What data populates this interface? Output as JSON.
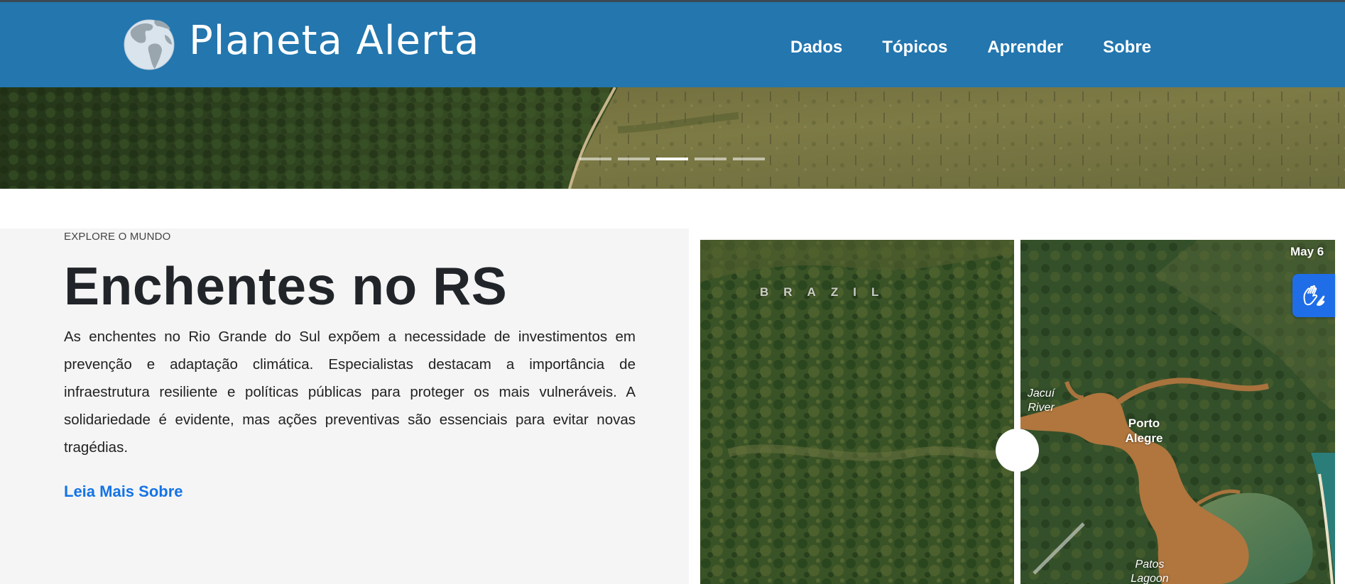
{
  "header": {
    "brand": "Planeta Alerta",
    "logo_icon": "globe-icon",
    "background": "#2376ae",
    "nav": [
      {
        "label": "Dados"
      },
      {
        "label": "Tópicos"
      },
      {
        "label": "Aprender"
      },
      {
        "label": "Sobre"
      }
    ]
  },
  "hero": {
    "slides_total": 5,
    "active_slide": 3
  },
  "feature": {
    "eyebrow": "EXPLORE O MUNDO",
    "title": "Enchentes no RS",
    "description": "As enchentes no Rio Grande do Sul expõem a necessidade de investimentos em prevenção e adaptação climática. Especialistas destacam a importância de infraestrutura resiliente e políticas públicas para proteger os mais vulneráveis. A solidariedade é evidente, mas ações preventivas são essenciais para evitar novas tragédias.",
    "read_more": "Leia Mais Sobre",
    "link_color": "#1473e6"
  },
  "comparison": {
    "label_country": "BRAZIL",
    "label_date": "May 6",
    "label_river": "Jacuí River",
    "label_city": "Porto Alegre",
    "label_lagoon": "Patos Lagoon",
    "slider_position": 0.5
  },
  "accessibility": {
    "icon": "sign-language-hands-icon",
    "color": "#1f6ee8"
  }
}
